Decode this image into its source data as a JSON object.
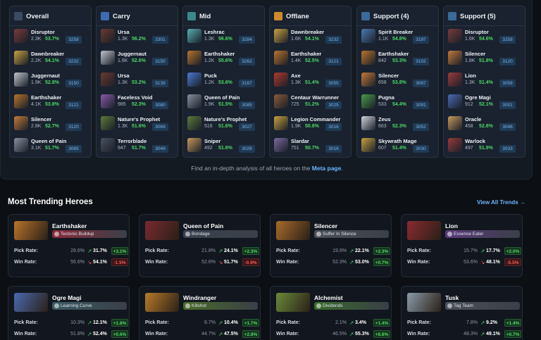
{
  "roles": [
    {
      "title": "Overall",
      "icon": "overall-icon",
      "color": "#3a4b63",
      "heroes": [
        {
          "name": "Disruptor",
          "games": "2.3K",
          "winrate": "53.7%",
          "rank": "3258",
          "color": "#7a3b3b"
        },
        {
          "name": "Dawnbreaker",
          "games": "2.2K",
          "winrate": "54.1%",
          "rank": "3232",
          "color": "#c8a040"
        },
        {
          "name": "Juggernaut",
          "games": "1.9K",
          "winrate": "52.8%",
          "rank": "3150",
          "color": "#c0c4cc"
        },
        {
          "name": "Earthshaker",
          "games": "4.1K",
          "winrate": "53.8%",
          "rank": "3121",
          "color": "#b8742c"
        },
        {
          "name": "Silencer",
          "games": "2.8K",
          "winrate": "52.7%",
          "rank": "3120",
          "color": "#c47a3a"
        },
        {
          "name": "Queen of Pain",
          "games": "3.1K",
          "winrate": "51.7%",
          "rank": "3085",
          "color": "#8a8fa0"
        }
      ]
    },
    {
      "title": "Carry",
      "icon": "sword-icon",
      "color": "#3d6bb3",
      "heroes": [
        {
          "name": "Ursa",
          "games": "1.3K",
          "winrate": "56.2%",
          "rank": "3301",
          "color": "#6b3a2e"
        },
        {
          "name": "Juggernaut",
          "games": "1.6K",
          "winrate": "52.6%",
          "rank": "3150",
          "color": "#c0c4cc"
        },
        {
          "name": "Ursa",
          "games": "1.3K",
          "winrate": "53.2%",
          "rank": "3139",
          "color": "#6b3a2e"
        },
        {
          "name": "Faceless Void",
          "games": "985",
          "winrate": "52.3%",
          "rank": "3080",
          "color": "#8a5aa8"
        },
        {
          "name": "Nature's Prophet",
          "games": "1.3K",
          "winrate": "51.6%",
          "rank": "3069",
          "color": "#5c7a3a"
        },
        {
          "name": "Terrorblade",
          "games": "947",
          "winrate": "51.7%",
          "rank": "3049",
          "color": "#4a5060"
        }
      ]
    },
    {
      "title": "Mid",
      "icon": "mid-icon",
      "color": "#3a8a8a",
      "heroes": [
        {
          "name": "Leshrac",
          "games": "1.3K",
          "winrate": "56.6%",
          "rank": "3284",
          "color": "#5ab0b0"
        },
        {
          "name": "Earthshaker",
          "games": "1.2K",
          "winrate": "55.6%",
          "rank": "3262",
          "color": "#b8742c"
        },
        {
          "name": "Puck",
          "games": "1.2K",
          "winrate": "53.6%",
          "rank": "3167",
          "color": "#4a7ad0"
        },
        {
          "name": "Queen of Pain",
          "games": "1.9K",
          "winrate": "51.5%",
          "rank": "3085",
          "color": "#8a8fa0"
        },
        {
          "name": "Nature's Prophet",
          "games": "516",
          "winrate": "51.6%",
          "rank": "3027",
          "color": "#5c7a3a"
        },
        {
          "name": "Sniper",
          "games": "492",
          "winrate": "51.6%",
          "rank": "3026",
          "color": "#c89a5a"
        }
      ]
    },
    {
      "title": "Offlane",
      "icon": "offlane-icon",
      "color": "#d08a2a",
      "heroes": [
        {
          "name": "Dawnbreaker",
          "games": "1.6K",
          "winrate": "54.1%",
          "rank": "3232",
          "color": "#c8a040"
        },
        {
          "name": "Earthshaker",
          "games": "1.4K",
          "winrate": "52.5%",
          "rank": "3121",
          "color": "#b8742c"
        },
        {
          "name": "Axe",
          "games": "1.3K",
          "winrate": "51.4%",
          "rank": "3055",
          "color": "#b03a2e"
        },
        {
          "name": "Centaur Warrunner",
          "games": "725",
          "winrate": "51.2%",
          "rank": "3025",
          "color": "#8a5a3a"
        },
        {
          "name": "Legion Commander",
          "games": "1.9K",
          "winrate": "50.8%",
          "rank": "3016",
          "color": "#c8a040"
        },
        {
          "name": "Slardar",
          "games": "751",
          "winrate": "50.7%",
          "rank": "3016",
          "color": "#7a6aa0"
        }
      ]
    },
    {
      "title": "Support (4)",
      "icon": "support-icon",
      "color": "#3a6a9a",
      "heroes": [
        {
          "name": "Spirit Breaker",
          "games": "1.1K",
          "winrate": "54.8%",
          "rank": "3197",
          "color": "#4a7ab0"
        },
        {
          "name": "Earthshaker",
          "games": "842",
          "winrate": "53.3%",
          "rank": "3102",
          "color": "#b8742c"
        },
        {
          "name": "Silencer",
          "games": "658",
          "winrate": "53.8%",
          "rank": "3097",
          "color": "#c47a3a"
        },
        {
          "name": "Pugna",
          "games": "533",
          "winrate": "54.4%",
          "rank": "3091",
          "color": "#4a9a4a"
        },
        {
          "name": "Zeus",
          "games": "663",
          "winrate": "52.3%",
          "rank": "3052",
          "color": "#d0d4dc"
        },
        {
          "name": "Skywrath Mage",
          "games": "607",
          "winrate": "51.4%",
          "rank": "3030",
          "color": "#c8a040"
        }
      ]
    },
    {
      "title": "Support (5)",
      "icon": "support-icon",
      "color": "#3a6a9a",
      "heroes": [
        {
          "name": "Disruptor",
          "games": "1.6K",
          "winrate": "54.6%",
          "rank": "3258",
          "color": "#7a3b3b"
        },
        {
          "name": "Silencer",
          "games": "1.8K",
          "winrate": "51.8%",
          "rank": "3120",
          "color": "#c47a3a"
        },
        {
          "name": "Lion",
          "games": "1.3K",
          "winrate": "51.4%",
          "rank": "3058",
          "color": "#9a3a3a"
        },
        {
          "name": "Ogre Magi",
          "games": "912",
          "winrate": "52.1%",
          "rank": "3051",
          "color": "#4a6ab0"
        },
        {
          "name": "Oracle",
          "games": "458",
          "winrate": "52.8%",
          "rank": "3046",
          "color": "#c89a5a"
        },
        {
          "name": "Warlock",
          "games": "497",
          "winrate": "51.9%",
          "rank": "3033",
          "color": "#9a3a3a"
        }
      ]
    }
  ],
  "meta": {
    "prefix": "Find an in-depth analysis of all heroes on the ",
    "link": "Meta page",
    "suffix": "."
  },
  "trending": {
    "title": "Most Trending Heroes",
    "view_all": "View All Trends →",
    "pick_label": "Pick Rate:",
    "win_label": "Win Rate:",
    "heroes": [
      {
        "name": "Earthshaker",
        "tag": "Tectonic Buildup",
        "tag_color": "#8a2a3a",
        "img_color": "#b8742c",
        "pick_old": "28.6%",
        "pick_new": "31.7%",
        "pick_delta": "+3.1%",
        "pick_dir": "up",
        "win_old": "55.6%",
        "win_new": "54.1%",
        "win_delta": "-1.5%",
        "win_dir": "down"
      },
      {
        "name": "Queen of Pain",
        "tag": "Bondage",
        "tag_color": "#3a4250",
        "img_color": "#7a2a30",
        "pick_old": "21.8%",
        "pick_new": "24.1%",
        "pick_delta": "+2.3%",
        "pick_dir": "up",
        "win_old": "52.6%",
        "win_new": "51.7%",
        "win_delta": "-0.9%",
        "win_dir": "down"
      },
      {
        "name": "Silencer",
        "tag": "Suffer In Silence",
        "tag_color": "#4a5058",
        "img_color": "#a86a2a",
        "pick_old": "19.9%",
        "pick_new": "22.1%",
        "pick_delta": "+2.3%",
        "pick_dir": "up",
        "win_old": "52.3%",
        "win_new": "53.0%",
        "win_delta": "+0.7%",
        "win_dir": "up"
      },
      {
        "name": "Lion",
        "tag": "Essence Eater",
        "tag_color": "#5a3a7a",
        "img_color": "#8a2a30",
        "pick_old": "15.7%",
        "pick_new": "17.7%",
        "pick_delta": "+2.0%",
        "pick_dir": "up",
        "win_old": "53.6%",
        "win_new": "48.1%",
        "win_delta": "-5.5%",
        "win_dir": "down"
      },
      {
        "name": "Ogre Magi",
        "tag": "Learning Curve",
        "tag_color": "#3a5a62",
        "img_color": "#4a6ab0",
        "pick_old": "10.3%",
        "pick_new": "12.1%",
        "pick_delta": "+1.8%",
        "pick_dir": "up",
        "win_old": "51.8%",
        "win_new": "52.4%",
        "win_delta": "+0.6%",
        "win_dir": "up"
      },
      {
        "name": "Windranger",
        "tag": "Killshot",
        "tag_color": "#4a6a2a",
        "img_color": "#b87a2a",
        "pick_old": "8.7%",
        "pick_new": "10.4%",
        "pick_delta": "+1.7%",
        "pick_dir": "up",
        "win_old": "44.7%",
        "win_new": "47.5%",
        "win_delta": "+2.8%",
        "win_dir": "up"
      },
      {
        "name": "Alchemist",
        "tag": "Dividends",
        "tag_color": "#3a6a2a",
        "img_color": "#6a8a3a",
        "pick_old": "2.1%",
        "pick_new": "3.4%",
        "pick_delta": "+1.4%",
        "pick_dir": "up",
        "win_old": "46.5%",
        "win_new": "55.3%",
        "win_delta": "+8.8%",
        "win_dir": "up"
      },
      {
        "name": "Tusk",
        "tag": "Tag Team",
        "tag_color": "#4a5058",
        "img_color": "#8a9aa8",
        "pick_old": "7.8%",
        "pick_new": "9.2%",
        "pick_delta": "+1.4%",
        "pick_dir": "up",
        "win_old": "48.3%",
        "win_new": "49.1%",
        "win_delta": "+0.7%",
        "win_dir": "up"
      }
    ]
  }
}
